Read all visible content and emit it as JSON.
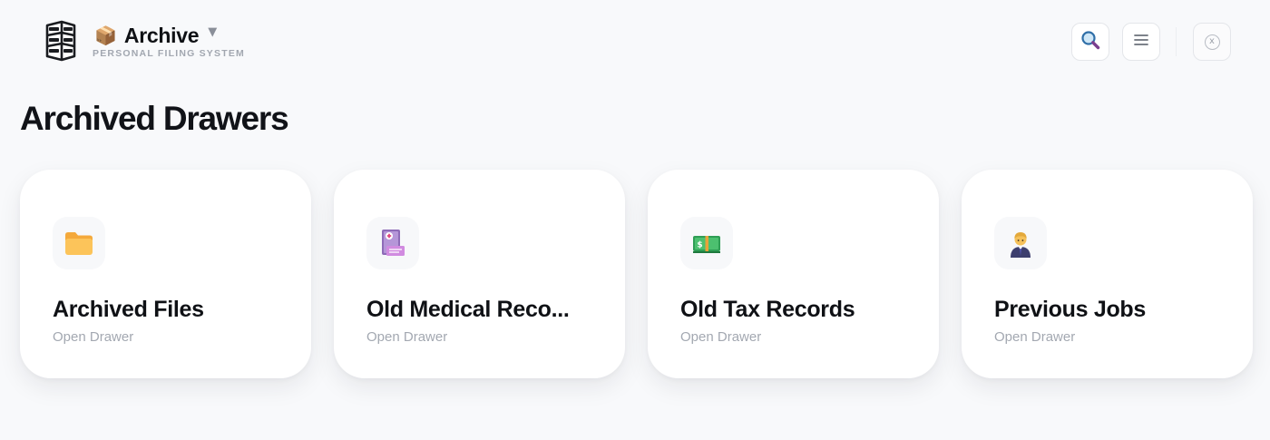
{
  "app": {
    "title": "Archive",
    "subtitle": "PERSONAL FILING SYSTEM",
    "emoji": "📦",
    "caret": "▼"
  },
  "header": {
    "icons": {
      "logo": "filing-cabinet-icon",
      "search": "search-icon",
      "menu": "hamburger-menu-icon",
      "close": "close-icon",
      "close_glyph": "x"
    }
  },
  "page": {
    "title": "Archived Drawers"
  },
  "drawers": [
    {
      "title": "Archived Files",
      "subtitle": "Open Drawer",
      "icon": "folder-icon"
    },
    {
      "title": "Old Medical Reco...",
      "subtitle": "Open Drawer",
      "icon": "medical-record-icon"
    },
    {
      "title": "Old Tax Records",
      "subtitle": "Open Drawer",
      "icon": "money-icon"
    },
    {
      "title": "Previous Jobs",
      "subtitle": "Open Drawer",
      "icon": "office-worker-icon"
    }
  ],
  "colors": {
    "background": "#f8f9fb",
    "card": "#ffffff",
    "text": "#0f1115",
    "muted": "#a3a8b1"
  }
}
